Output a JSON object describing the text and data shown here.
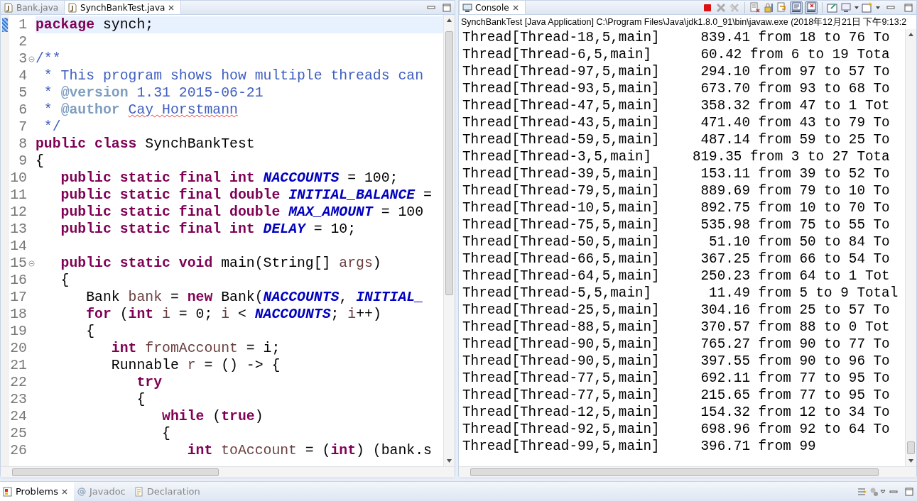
{
  "editor": {
    "tabs": [
      {
        "label": "Bank.java",
        "selected": false
      },
      {
        "label": "SynchBankTest.java",
        "selected": true
      }
    ],
    "lines": [
      {
        "n": "1",
        "current": true,
        "fold": false,
        "tokens": [
          {
            "kind": "kw",
            "text": "package"
          },
          {
            "kind": "plain",
            "text": " synch;"
          }
        ]
      },
      {
        "n": "2",
        "current": false,
        "fold": false
      },
      {
        "n": "3",
        "current": false,
        "fold": true,
        "tokens": [
          {
            "kind": "comment",
            "text": "/**"
          }
        ]
      },
      {
        "n": "4",
        "current": false,
        "fold": false,
        "tokens": [
          {
            "kind": "comment",
            "text": " * This program shows how multiple threads can"
          }
        ]
      },
      {
        "n": "5",
        "current": false,
        "fold": false,
        "tokens": [
          {
            "kind": "comment",
            "text": " * "
          },
          {
            "kind": "tag",
            "text": "@version"
          },
          {
            "kind": "comment",
            "text": " 1.31 2015-06-21"
          }
        ]
      },
      {
        "n": "6",
        "current": false,
        "fold": false,
        "tokens": [
          {
            "kind": "comment",
            "text": " * "
          },
          {
            "kind": "tag",
            "text": "@author "
          },
          {
            "kind": "spell",
            "text": "Cay Horstmann"
          }
        ]
      },
      {
        "n": "7",
        "current": false,
        "fold": false,
        "tokens": [
          {
            "kind": "comment",
            "text": " */"
          }
        ]
      },
      {
        "n": "8",
        "current": false,
        "fold": false,
        "tokens": [
          {
            "kind": "kw",
            "text": "public class"
          },
          {
            "kind": "plain",
            "text": " SynchBankTest"
          }
        ]
      },
      {
        "n": "9",
        "current": false,
        "fold": false,
        "tokens": [
          {
            "kind": "plain",
            "text": "{"
          }
        ]
      },
      {
        "n": "10",
        "current": false,
        "fold": false,
        "tokens": [
          {
            "kind": "kw",
            "text": "   public static final int "
          },
          {
            "kind": "field",
            "text": "NACCOUNTS"
          },
          {
            "kind": "plain",
            "text": " = 100;"
          }
        ]
      },
      {
        "n": "11",
        "current": false,
        "fold": false,
        "tokens": [
          {
            "kind": "kw",
            "text": "   public static final double "
          },
          {
            "kind": "field",
            "text": "INITIAL_BALANCE"
          },
          {
            "kind": "plain",
            "text": " ="
          }
        ]
      },
      {
        "n": "12",
        "current": false,
        "fold": false,
        "tokens": [
          {
            "kind": "kw",
            "text": "   public static final double "
          },
          {
            "kind": "field",
            "text": "MAX_AMOUNT"
          },
          {
            "kind": "plain",
            "text": " = 100"
          }
        ]
      },
      {
        "n": "13",
        "current": false,
        "fold": false,
        "tokens": [
          {
            "kind": "kw",
            "text": "   public static final int "
          },
          {
            "kind": "field",
            "text": "DELAY"
          },
          {
            "kind": "plain",
            "text": " = 10;"
          }
        ]
      },
      {
        "n": "14",
        "current": false,
        "fold": false
      },
      {
        "n": "15",
        "current": false,
        "fold": true,
        "tokens": [
          {
            "kind": "kw",
            "text": "   public static void"
          },
          {
            "kind": "plain",
            "text": " main(String[] "
          },
          {
            "kind": "local",
            "text": "args"
          },
          {
            "kind": "plain",
            "text": ")"
          }
        ]
      },
      {
        "n": "16",
        "current": false,
        "fold": false,
        "tokens": [
          {
            "kind": "plain",
            "text": "   {"
          }
        ]
      },
      {
        "n": "17",
        "current": false,
        "fold": false,
        "tokens": [
          {
            "kind": "plain",
            "text": "      Bank "
          },
          {
            "kind": "local",
            "text": "bank"
          },
          {
            "kind": "plain",
            "text": " = "
          },
          {
            "kind": "kw",
            "text": "new"
          },
          {
            "kind": "plain",
            "text": " Bank("
          },
          {
            "kind": "field",
            "text": "NACCOUNTS"
          },
          {
            "kind": "plain",
            "text": ", "
          },
          {
            "kind": "field",
            "text": "INITIAL_"
          }
        ]
      },
      {
        "n": "18",
        "current": false,
        "fold": false,
        "tokens": [
          {
            "kind": "kw",
            "text": "      for"
          },
          {
            "kind": "plain",
            "text": " ("
          },
          {
            "kind": "kw",
            "text": "int "
          },
          {
            "kind": "local",
            "text": "i"
          },
          {
            "kind": "plain",
            "text": " = 0; "
          },
          {
            "kind": "local",
            "text": "i"
          },
          {
            "kind": "plain",
            "text": " < "
          },
          {
            "kind": "field",
            "text": "NACCOUNTS"
          },
          {
            "kind": "plain",
            "text": "; "
          },
          {
            "kind": "local",
            "text": "i"
          },
          {
            "kind": "plain",
            "text": "++)"
          }
        ]
      },
      {
        "n": "19",
        "current": false,
        "fold": false,
        "tokens": [
          {
            "kind": "plain",
            "text": "      {"
          }
        ]
      },
      {
        "n": "20",
        "current": false,
        "fold": false,
        "tokens": [
          {
            "kind": "kw",
            "text": "         int "
          },
          {
            "kind": "local",
            "text": "fromAccount"
          },
          {
            "kind": "plain",
            "text": " = i;"
          }
        ]
      },
      {
        "n": "21",
        "current": false,
        "fold": false,
        "tokens": [
          {
            "kind": "plain",
            "text": "         Runnable "
          },
          {
            "kind": "local",
            "text": "r"
          },
          {
            "kind": "plain",
            "text": " = () -> {"
          }
        ]
      },
      {
        "n": "22",
        "current": false,
        "fold": false,
        "tokens": [
          {
            "kind": "kw",
            "text": "            try"
          }
        ]
      },
      {
        "n": "23",
        "current": false,
        "fold": false,
        "tokens": [
          {
            "kind": "plain",
            "text": "            {"
          }
        ]
      },
      {
        "n": "24",
        "current": false,
        "fold": false,
        "tokens": [
          {
            "kind": "kw",
            "text": "               while"
          },
          {
            "kind": "plain",
            "text": " ("
          },
          {
            "kind": "kw",
            "text": "true"
          },
          {
            "kind": "plain",
            "text": ")"
          }
        ]
      },
      {
        "n": "25",
        "current": false,
        "fold": false,
        "tokens": [
          {
            "kind": "plain",
            "text": "               {"
          }
        ]
      },
      {
        "n": "26",
        "current": false,
        "fold": false,
        "tokens": [
          {
            "kind": "kw",
            "text": "                  int "
          },
          {
            "kind": "local",
            "text": "toAccount"
          },
          {
            "kind": "plain",
            "text": " = ("
          },
          {
            "kind": "kw",
            "text": "int"
          },
          {
            "kind": "plain",
            "text": ") (bank.s"
          }
        ]
      }
    ]
  },
  "console": {
    "tab": {
      "label": "Console",
      "selected": true
    },
    "title": "SynchBankTest [Java Application] C:\\Program Files\\Java\\jdk1.8.0_91\\bin\\javaw.exe (2018年12月21日 下午9:13:2",
    "lines": [
      "Thread[Thread-18,5,main]     839.41 from 18 to 76 To",
      "Thread[Thread-6,5,main]      60.42 from 6 to 19 Tota",
      "Thread[Thread-97,5,main]     294.10 from 97 to 57 To",
      "Thread[Thread-93,5,main]     673.70 from 93 to 68 To",
      "Thread[Thread-47,5,main]     358.32 from 47 to 1 Tot",
      "Thread[Thread-43,5,main]     471.40 from 43 to 79 To",
      "Thread[Thread-59,5,main]     487.14 from 59 to 25 To",
      "Thread[Thread-3,5,main]     819.35 from 3 to 27 Tota",
      "Thread[Thread-39,5,main]     153.11 from 39 to 52 To",
      "Thread[Thread-79,5,main]     889.69 from 79 to 10 To",
      "Thread[Thread-10,5,main]     892.75 from 10 to 70 To",
      "Thread[Thread-75,5,main]     535.98 from 75 to 55 To",
      "Thread[Thread-50,5,main]      51.10 from 50 to 84 To",
      "Thread[Thread-66,5,main]     367.25 from 66 to 54 To",
      "Thread[Thread-64,5,main]     250.23 from 64 to 1 Tot",
      "Thread[Thread-5,5,main]       11.49 from 5 to 9 Total",
      "Thread[Thread-25,5,main]     304.16 from 25 to 57 To",
      "Thread[Thread-88,5,main]     370.57 from 88 to 0 Tot",
      "Thread[Thread-90,5,main]     765.27 from 90 to 77 To",
      "Thread[Thread-90,5,main]     397.55 from 90 to 96 To",
      "Thread[Thread-77,5,main]     692.11 from 77 to 95 To",
      "Thread[Thread-77,5,main]     215.65 from 77 to 95 To",
      "Thread[Thread-12,5,main]     154.32 from 12 to 34 To",
      "Thread[Thread-92,5,main]     698.96 from 92 to 64 To",
      "Thread[Thread-99,5,main]     396.71 from 99"
    ]
  },
  "bottom_panel": {
    "tabs": [
      {
        "label": "Problems",
        "kind": "problems",
        "selected": true
      },
      {
        "label": "Javadoc",
        "kind": "javadoc",
        "selected": false
      },
      {
        "label": "Declaration",
        "kind": "declaration",
        "selected": false
      }
    ]
  }
}
